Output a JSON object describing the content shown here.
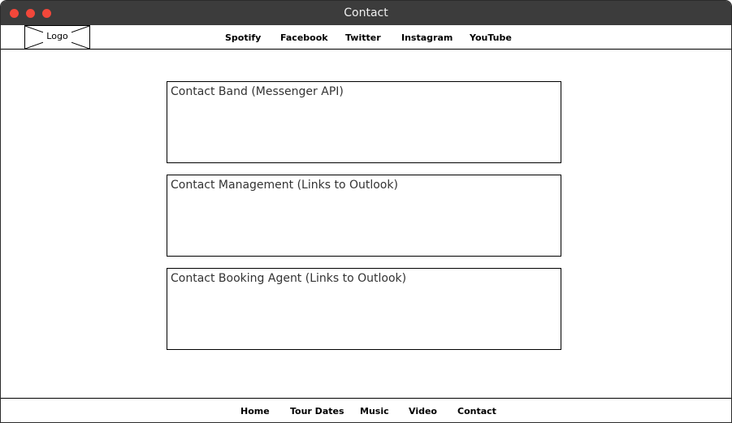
{
  "window": {
    "title": "Contact"
  },
  "header": {
    "logo_label": "Logo",
    "nav": [
      {
        "label": "Spotify"
      },
      {
        "label": "Facebook"
      },
      {
        "label": "Twitter"
      },
      {
        "label": "Instagram"
      },
      {
        "label": "YouTube"
      }
    ]
  },
  "main": {
    "contact_boxes": [
      {
        "label": "Contact Band (Messenger API)"
      },
      {
        "label": "Contact Management (Links to Outlook)"
      },
      {
        "label": "Contact Booking Agent (Links to Outlook)"
      }
    ]
  },
  "footer": {
    "nav": [
      {
        "label": "Home"
      },
      {
        "label": "Tour Dates"
      },
      {
        "label": "Music"
      },
      {
        "label": "Video"
      },
      {
        "label": "Contact"
      }
    ]
  },
  "colors": {
    "titlebar": "#3c3c3c",
    "traffic_light": "#f2473a",
    "border": "#000000"
  }
}
